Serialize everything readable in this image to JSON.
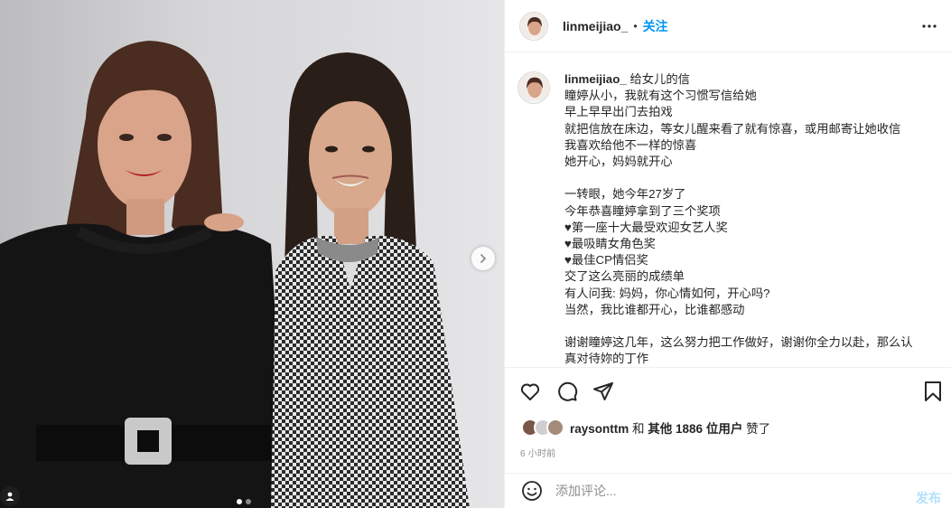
{
  "post": {
    "slide_count": 2,
    "active_slide": 1
  },
  "header": {
    "username": "linmeijiao_",
    "separator": "•",
    "follow_label": "关注"
  },
  "caption": {
    "username": "linmeijiao_",
    "title": "给女儿的信",
    "lines": [
      "瞳婷从小，我就有这个习惯写信给她",
      "早上早早出门去拍戏",
      "就把信放在床边，等女儿醒来看了就有惊喜，或用邮寄让她收信",
      "我喜欢给他不一样的惊喜",
      "她开心，妈妈就开心",
      "",
      "一转眼，她今年27岁了",
      "今年恭喜瞳婷拿到了三个奖项",
      "♥第一座十大最受欢迎女艺人奖",
      "♥最吸睛女角色奖",
      "♥最佳CP情侣奖",
      "交了这么亮丽的成绩单",
      "有人问我: 妈妈，你心情如何，开心吗?",
      "当然，我比谁都开心，比谁都感动",
      "",
      "谢谢瞳婷这几年，这么努力把工作做好，谢谢你全力以赴，那么认",
      "真对待妳的丁作"
    ]
  },
  "likes": {
    "user": "raysonttm",
    "middle": " 和 ",
    "others": "其他 1886 位用户",
    "suffix": " 赞了"
  },
  "timestamp": "6 小时前",
  "comment": {
    "placeholder": "添加评论...",
    "post_label": "发布"
  },
  "icons": {
    "like": "heart-icon",
    "comment": "comment-icon",
    "share": "send-icon",
    "save": "bookmark-icon",
    "more": "more-horizontal-icon",
    "emoji": "emoji-icon",
    "next": "chevron-right-icon",
    "tag": "user-tag-icon"
  },
  "colors": {
    "accent": "#0095f6",
    "post_disabled": "#b2dffc",
    "muted": "#8e8e8e",
    "text": "#262626"
  }
}
